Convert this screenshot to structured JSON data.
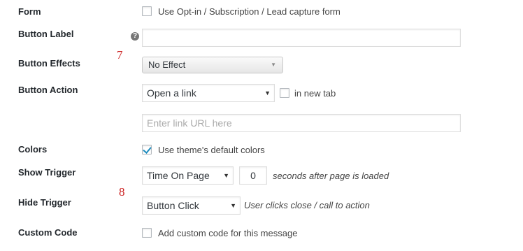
{
  "rows": {
    "form": {
      "label": "Form",
      "checkbox_text": "Use Opt-in / Subscription / Lead capture form",
      "checked": false
    },
    "button_label": {
      "label": "Button Label",
      "value": ""
    },
    "button_effects": {
      "label": "Button Effects",
      "selected": "No Effect"
    },
    "button_action": {
      "label": "Button Action",
      "selected": "Open a link",
      "new_tab_text": "in new tab",
      "url_placeholder": "Enter link URL here"
    },
    "colors": {
      "label": "Colors",
      "checkbox_text": "Use theme's default colors",
      "checked": true
    },
    "show_trigger": {
      "label": "Show Trigger",
      "selected": "Time On Page",
      "seconds_value": "0",
      "hint": "seconds after page is loaded"
    },
    "hide_trigger": {
      "label": "Hide Trigger",
      "selected": "Button Click",
      "hint": "User clicks close / call to action"
    },
    "custom_code": {
      "label": "Custom Code",
      "checkbox_text": "Add custom code for this message",
      "checked": false
    }
  },
  "annotations": {
    "marker_7": "7",
    "marker_8": "8"
  },
  "icons": {
    "help": "?",
    "dropdown": "▼"
  },
  "colors": {
    "label_text": "#23282d",
    "body_text": "#444444",
    "checkmark": "#1e8cbe",
    "annotation": "#cc2222",
    "border": "#dddddd"
  }
}
